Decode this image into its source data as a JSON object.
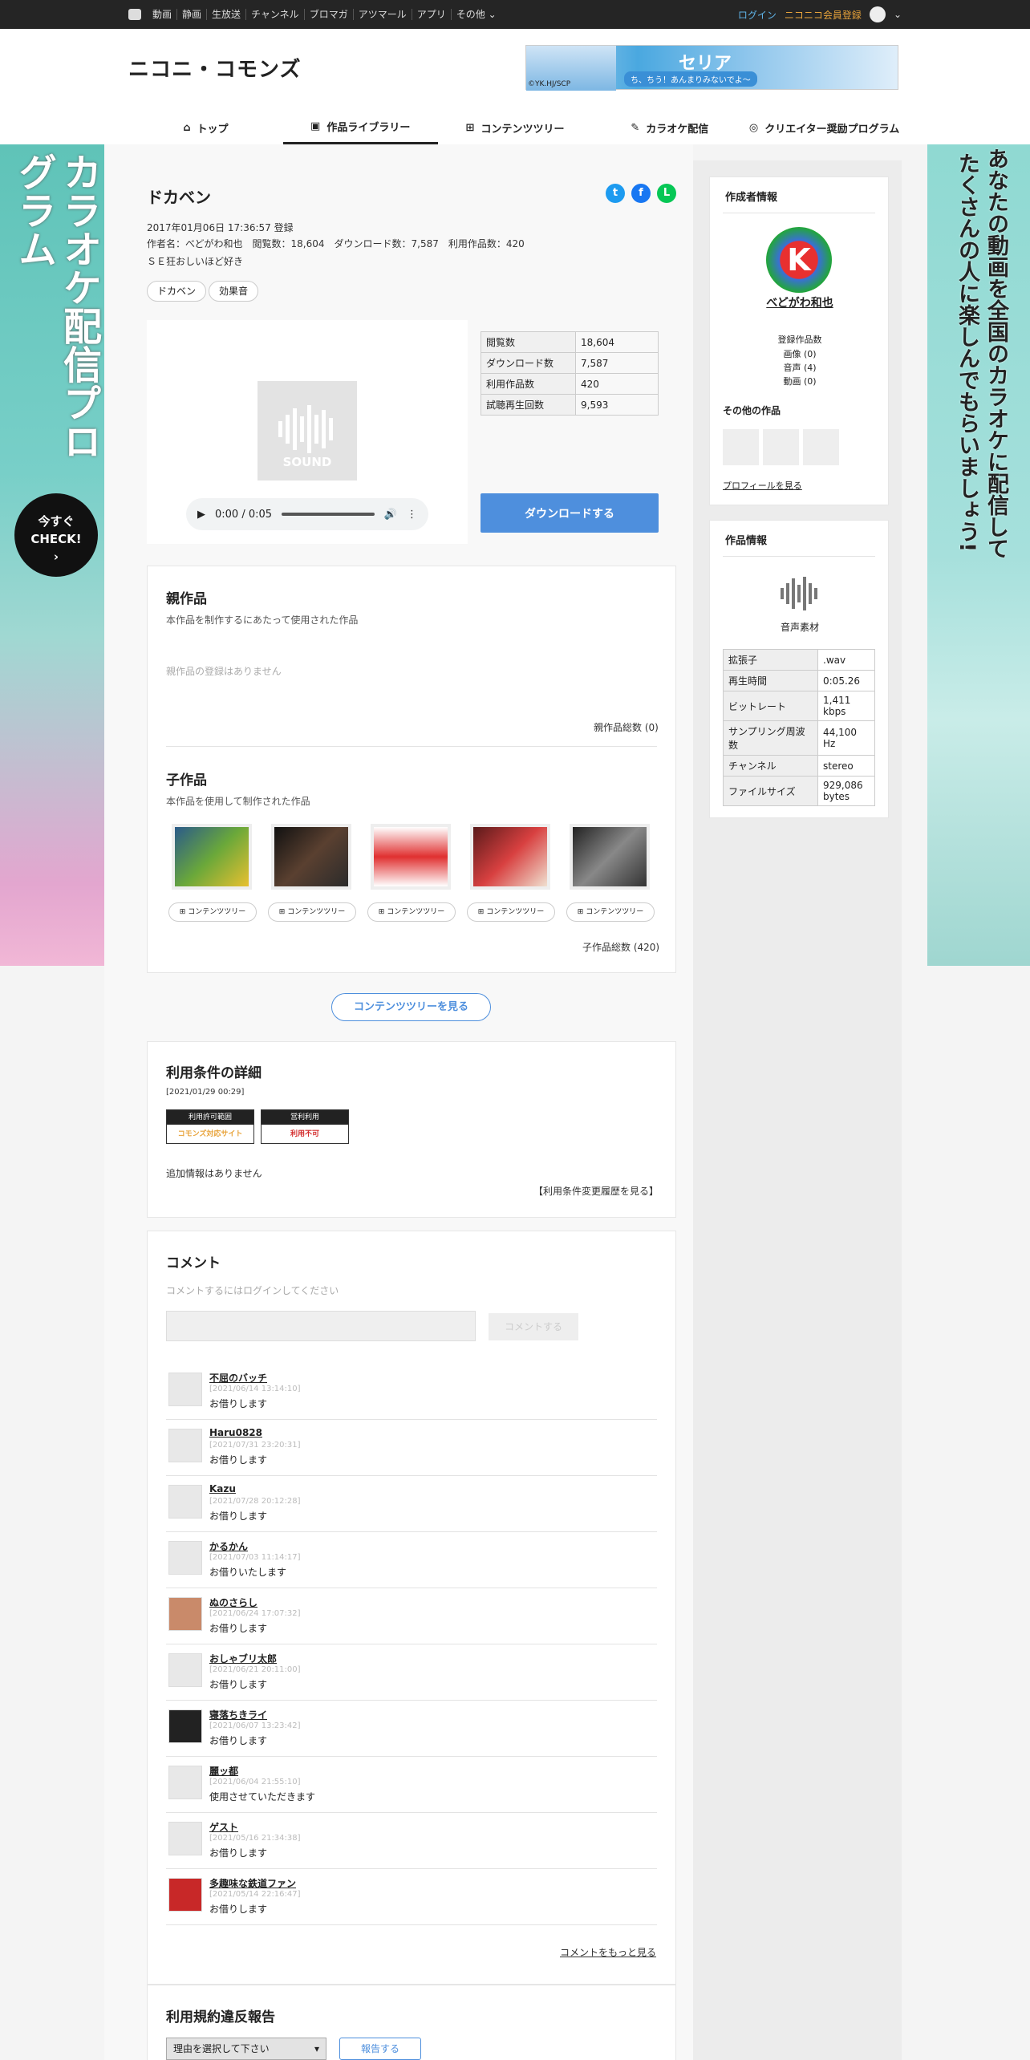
{
  "topbar": {
    "items": [
      "動画",
      "静画",
      "生放送",
      "チャンネル",
      "ブロマガ",
      "アツマール",
      "アプリ",
      "その他"
    ],
    "login": "ログイン",
    "register": "ニコニコ会員登録"
  },
  "header": {
    "logo": "ニコニ・コモンズ",
    "banner_title": "セリア",
    "banner_sub": "ち、ちう！あんまりみないでよ～",
    "banner_credit": "©YK.HJ/SCP"
  },
  "nav": {
    "tabs": [
      "トップ",
      "作品ライブラリー",
      "コンテンツツリー",
      "カラオケ配信",
      "クリエイター奨励プログラム"
    ]
  },
  "ads": {
    "left_text": "カラオケ配信プログラム",
    "left_button": "今すぐ\nCHECK!",
    "right_text_1": "あなたの動画を全国のカラオケに配信して",
    "right_text_2": "たくさんの人に楽しんでもらいましょう!"
  },
  "work": {
    "title": "ドカベン",
    "registered": "2017年01月06日 17:36:57 登録",
    "info": "作者名：べどがわ和也　閲覧数：18,604　ダウンロード数：7,587　利用作品数：420",
    "description": "ＳＥ狂おしいほど好き",
    "tags": [
      "ドカベン",
      "効果音"
    ],
    "sound_label": "SOUND",
    "audio_time": "0:00 / 0:05",
    "stats": [
      {
        "k": "閲覧数",
        "v": "18,604"
      },
      {
        "k": "ダウンロード数",
        "v": "7,587"
      },
      {
        "k": "利用作品数",
        "v": "420"
      },
      {
        "k": "試聴再生回数",
        "v": "9,593"
      }
    ],
    "download": "ダウンロードする"
  },
  "parent": {
    "title": "親作品",
    "sub": "本作品を制作するにあたって使用された作品",
    "empty": "親作品の登録はありません",
    "total": "親作品総数 (0)"
  },
  "children": {
    "title": "子作品",
    "sub": "本作品を使用して制作された作品",
    "tree_label": "コンテンツツリー",
    "total": "子作品総数 (420)"
  },
  "tree_button": "コンテンツツリーを見る",
  "license": {
    "title": "利用条件の詳細",
    "date": "[2021/01/29 00:29]",
    "badge1_head": "利用許可範囲",
    "badge1_val": "コモンズ対応サイト",
    "badge2_head": "営利利用",
    "badge2_val": "利用不可",
    "extra": "追加情報はありません",
    "history": "【利用条件変更履歴を見る】"
  },
  "comments": {
    "title": "コメント",
    "login_note": "コメントするにはログインしてください",
    "submit": "コメントする",
    "more": "コメントをもっと見る",
    "items": [
      {
        "name": "不屈のバッチ",
        "time": "[2021/06/14 13:14:10]",
        "text": "お借りします"
      },
      {
        "name": "Haru0828",
        "time": "[2021/07/31 23:20:31]",
        "text": "お借りします"
      },
      {
        "name": "Kazu",
        "time": "[2021/07/28 20:12:28]",
        "text": "お借りします"
      },
      {
        "name": "かるかん",
        "time": "[2021/07/03 11:14:17]",
        "text": "お借りいたします"
      },
      {
        "name": "ぬのさらし",
        "time": "[2021/06/24 17:07:32]",
        "text": "お借りします"
      },
      {
        "name": "おしゃブリ太郎",
        "time": "[2021/06/21 20:11:00]",
        "text": "お借りします"
      },
      {
        "name": "寝落ちきライ",
        "time": "[2021/06/07 13:23:42]",
        "text": "お借りします"
      },
      {
        "name": "麗ッ都",
        "time": "[2021/06/04 21:55:10]",
        "text": "使用させていただきます"
      },
      {
        "name": "ゲスト",
        "time": "[2021/05/16 21:34:38]",
        "text": "お借りします"
      },
      {
        "name": "多趣味な鉄道ファン",
        "time": "[2021/05/14 22:16:47]",
        "text": "お借りします"
      }
    ]
  },
  "report": {
    "title": "利用規約違反報告",
    "select": "理由を選択して下さい",
    "button": "報告する"
  },
  "author": {
    "section": "作成者情報",
    "name": "べどがわ和也",
    "avatar_letter": "K",
    "count_title": "登録作品数",
    "counts": [
      "画像 (0)",
      "音声 (4)",
      "動画 (0)"
    ],
    "other_works": "その他の作品",
    "profile": "プロフィールを見る"
  },
  "fileinfo": {
    "section": "作品情報",
    "type": "音声素材",
    "rows": [
      {
        "k": "拡張子",
        "v": ".wav"
      },
      {
        "k": "再生時間",
        "v": "0:05.26"
      },
      {
        "k": "ビットレート",
        "v": "1,411 kbps"
      },
      {
        "k": "サンプリング周波数",
        "v": "44,100 Hz"
      },
      {
        "k": "チャンネル",
        "v": "stereo"
      },
      {
        "k": "ファイルサイズ",
        "v": "929,086 bytes"
      }
    ]
  },
  "colors": {
    "accent": "#4e8fdd",
    "login": "#5fb4e8",
    "register": "#e8a33a"
  }
}
